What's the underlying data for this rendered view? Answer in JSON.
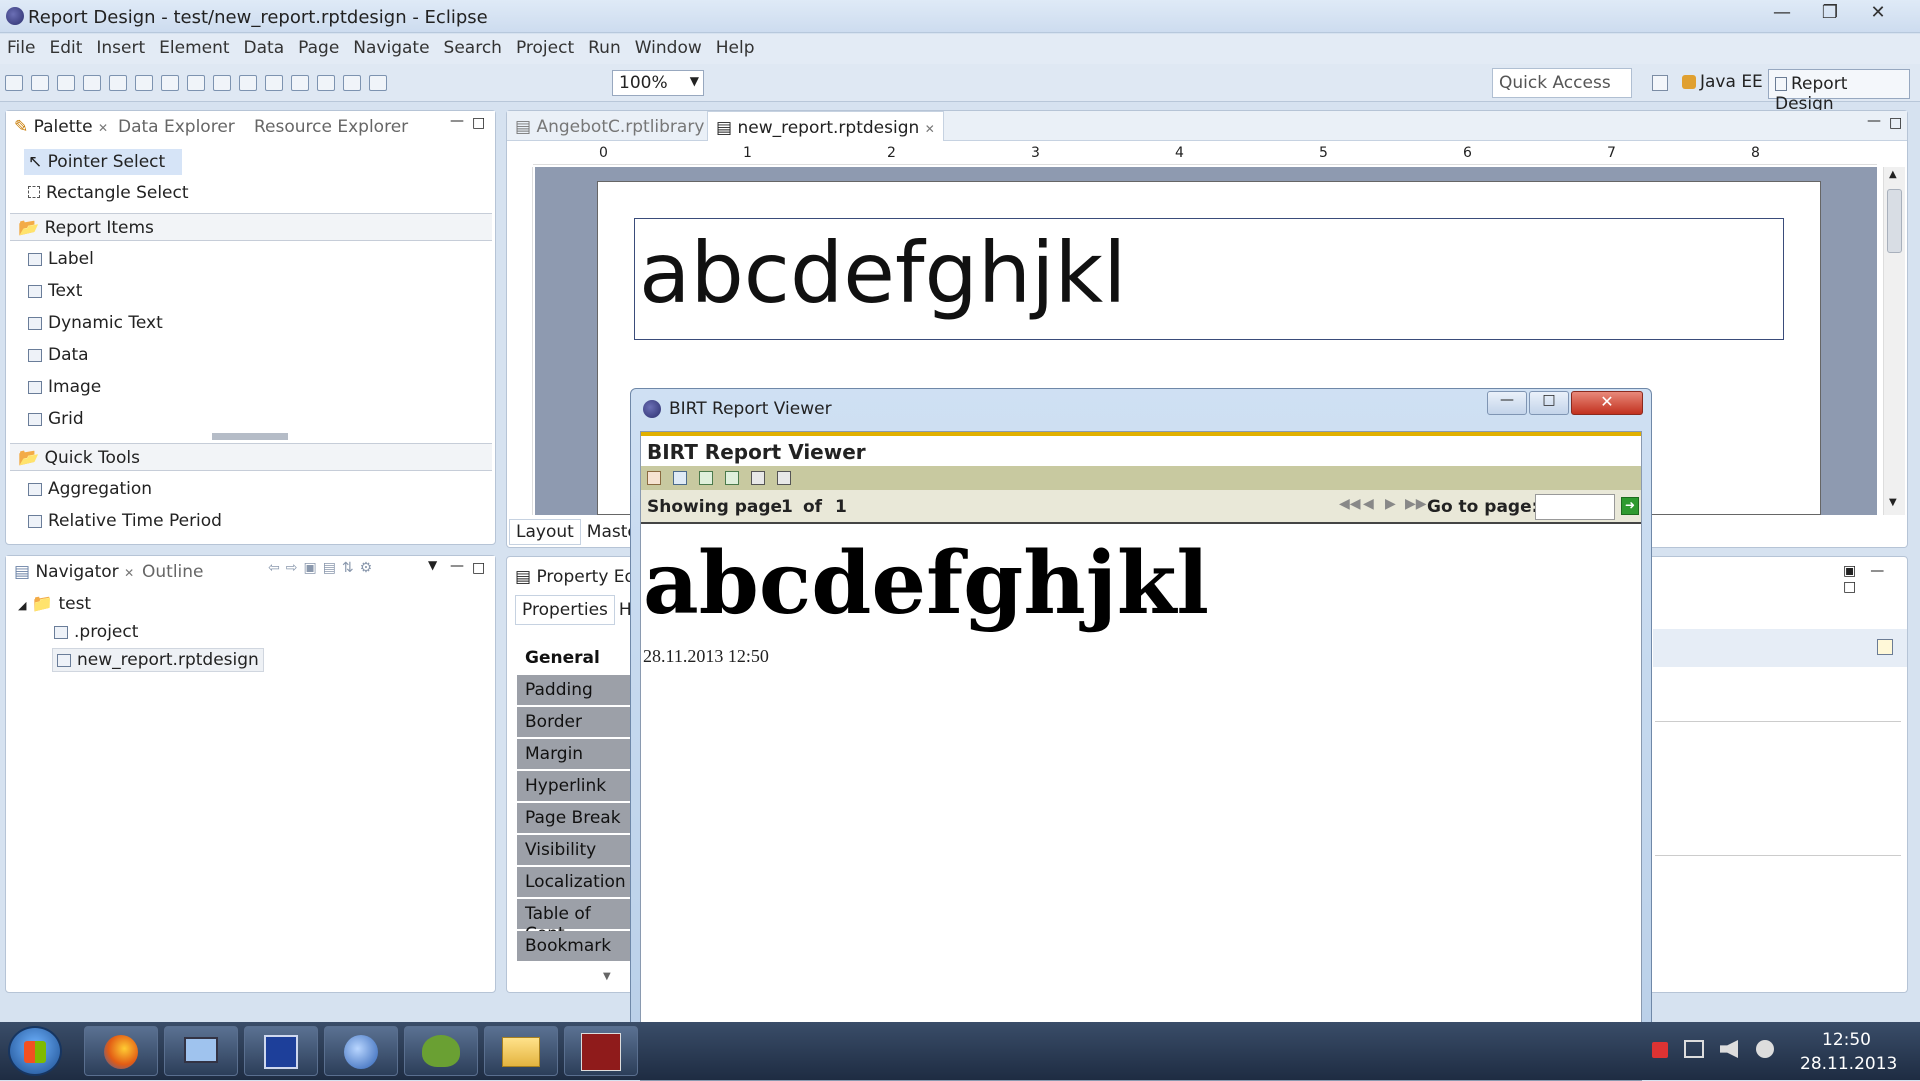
{
  "window": {
    "title": "Report Design - test/new_report.rptdesign - Eclipse"
  },
  "menus": [
    "File",
    "Edit",
    "Insert",
    "Element",
    "Data",
    "Page",
    "Navigate",
    "Search",
    "Project",
    "Run",
    "Window",
    "Help"
  ],
  "toolbar": {
    "zoom": "100%",
    "quick_access": "Quick Access",
    "perspective_java": "Java EE",
    "perspective_report": "Report Design"
  },
  "palette": {
    "tabs": [
      "Palette",
      "Data Explorer",
      "Resource Explorer"
    ],
    "tools": [
      "Pointer Select",
      "Rectangle Select"
    ],
    "report_items_header": "Report Items",
    "report_items": [
      "Label",
      "Text",
      "Dynamic Text",
      "Data",
      "Image",
      "Grid"
    ],
    "quick_tools_header": "Quick Tools",
    "quick_tools": [
      "Aggregation",
      "Relative Time Period"
    ]
  },
  "navigator": {
    "tabs": [
      "Navigator",
      "Outline"
    ],
    "project": "test",
    "files": [
      ".project",
      "new_report.rptdesign"
    ]
  },
  "editor": {
    "tabs": [
      "AngebotC.rptlibrary",
      "new_report.rptdesign"
    ],
    "ruler": [
      "0",
      "1",
      "2",
      "3",
      "4",
      "5",
      "6",
      "7",
      "8"
    ],
    "label_text": "abcdefghjkl",
    "bottom_tabs": [
      "Layout",
      "Master"
    ]
  },
  "property": {
    "title": "Property Edit",
    "tabs": [
      "Properties",
      "Hig"
    ],
    "items": [
      "General",
      "Padding",
      "Border",
      "Margin",
      "Hyperlink",
      "Page Break",
      "Visibility",
      "Localization",
      "Table of Cont",
      "Bookmark"
    ]
  },
  "viewer": {
    "window_title": "BIRT Report Viewer",
    "header": "BIRT Report Viewer",
    "showing": "Showing page",
    "page": "1",
    "of": "of",
    "total": "1",
    "goto": "Go to page:",
    "content": "abcdefghjkl",
    "date": "28.11.2013 12:50"
  },
  "taskbar": {
    "time": "12:50",
    "date": "28.11.2013"
  }
}
